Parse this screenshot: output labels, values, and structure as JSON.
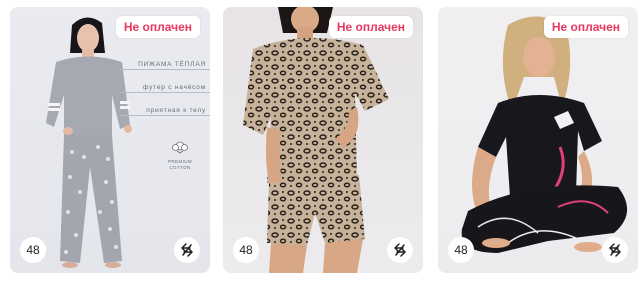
{
  "products": [
    {
      "status": "Не оплачен",
      "size": "48",
      "promo_lines": [
        "ПИЖАМА ТЁПЛАЯ",
        "футер с начёсом",
        "приятная к телу"
      ],
      "cotton_label": [
        "PREMIUM",
        "COTTON"
      ]
    },
    {
      "status": "Не оплачен",
      "size": "48"
    },
    {
      "status": "Не оплачен",
      "size": "48"
    }
  ],
  "colors": {
    "status_text": "#e8385f",
    "badge_bg": "#ffffff"
  },
  "icons": {
    "swap": "swap-icon",
    "cotton": "cotton-flower-icon"
  }
}
